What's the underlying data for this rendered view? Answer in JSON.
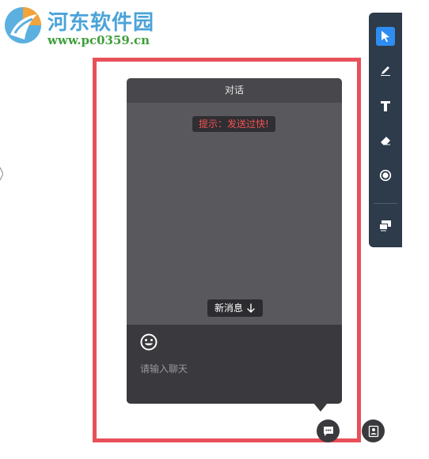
{
  "watermark": {
    "title": "河东软件园",
    "url": "www.pc0359.cn"
  },
  "dialog": {
    "title": "对话",
    "tip": "提示：发送过快!",
    "new_message_label": "新消息",
    "input_placeholder": "请输入聊天"
  },
  "toolbar": {
    "tools": [
      "select-icon",
      "pen-icon",
      "text-icon",
      "eraser-icon",
      "circle-icon",
      "screen-share-icon"
    ],
    "active_tool": "select-icon"
  },
  "colors": {
    "highlight_border": "#e8505a",
    "tip_text": "#f05252",
    "toolbar_bg": "#2d3b4a",
    "active_tool_bg": "#2f8cf0"
  }
}
